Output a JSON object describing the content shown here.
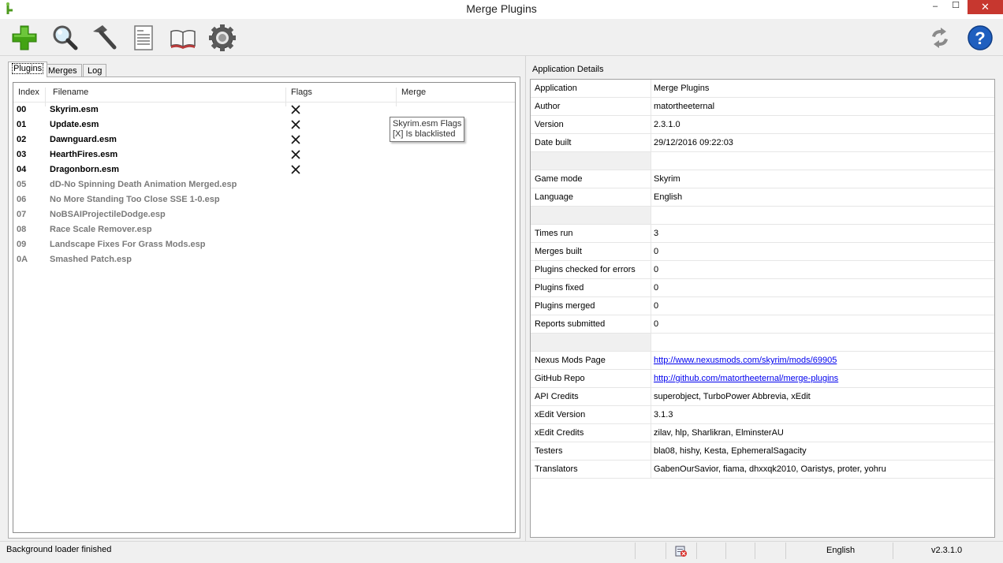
{
  "window": {
    "title": "Merge Plugins",
    "minimize": "–",
    "maximize": "☐",
    "close": "✕"
  },
  "tabs": [
    "Plugins",
    "Merges",
    "Log"
  ],
  "plugins": {
    "columns": [
      "Index",
      "Filename",
      "Flags",
      "Merge"
    ],
    "rows": [
      {
        "index": "00",
        "filename": "Skyrim.esm",
        "flag": true,
        "dim": false
      },
      {
        "index": "01",
        "filename": "Update.esm",
        "flag": true,
        "dim": false
      },
      {
        "index": "02",
        "filename": "Dawnguard.esm",
        "flag": true,
        "dim": false
      },
      {
        "index": "03",
        "filename": "HearthFires.esm",
        "flag": true,
        "dim": false
      },
      {
        "index": "04",
        "filename": "Dragonborn.esm",
        "flag": true,
        "dim": false
      },
      {
        "index": "05",
        "filename": "dD-No Spinning Death Animation Merged.esp",
        "flag": false,
        "dim": true
      },
      {
        "index": "06",
        "filename": "No More Standing Too Close SSE 1-0.esp",
        "flag": false,
        "dim": true
      },
      {
        "index": "07",
        "filename": "NoBSAIProjectileDodge.esp",
        "flag": false,
        "dim": true
      },
      {
        "index": "08",
        "filename": "Race Scale Remover.esp",
        "flag": false,
        "dim": true
      },
      {
        "index": "09",
        "filename": "Landscape Fixes For Grass Mods.esp",
        "flag": false,
        "dim": true
      },
      {
        "index": "0A",
        "filename": "Smashed Patch.esp",
        "flag": false,
        "dim": true
      }
    ],
    "tooltip": {
      "line1": "Skyrim.esm Flags",
      "line2": "[X] Is blacklisted"
    }
  },
  "details": {
    "heading": "Application Details",
    "rows": [
      {
        "key": "Application",
        "value": "Merge Plugins"
      },
      {
        "key": "Author",
        "value": "matortheeternal"
      },
      {
        "key": "Version",
        "value": "2.3.1.0"
      },
      {
        "key": "Date built",
        "value": "29/12/2016 09:22:03"
      },
      {
        "key": "",
        "value": "",
        "blank": true
      },
      {
        "key": "Game mode",
        "value": "Skyrim"
      },
      {
        "key": "Language",
        "value": "English"
      },
      {
        "key": "",
        "value": "",
        "blank": true
      },
      {
        "key": "Times run",
        "value": "3"
      },
      {
        "key": "Merges built",
        "value": "0"
      },
      {
        "key": "Plugins checked for errors",
        "value": "0"
      },
      {
        "key": "Plugins fixed",
        "value": "0"
      },
      {
        "key": "Plugins merged",
        "value": "0"
      },
      {
        "key": "Reports submitted",
        "value": "0"
      },
      {
        "key": "",
        "value": "",
        "blank": true
      },
      {
        "key": "Nexus Mods Page",
        "value": "http://www.nexusmods.com/skyrim/mods/69905",
        "link": true
      },
      {
        "key": "GitHub Repo",
        "value": "http://github.com/matortheeternal/merge-plugins",
        "link": true
      },
      {
        "key": "API Credits",
        "value": "superobject, TurboPower Abbrevia, xEdit"
      },
      {
        "key": "xEdit Version",
        "value": "3.1.3"
      },
      {
        "key": "xEdit Credits",
        "value": "zilav, hlp, Sharlikran, ElminsterAU"
      },
      {
        "key": "Testers",
        "value": "bla08, hishy, Kesta, EphemeralSagacity"
      },
      {
        "key": "Translators",
        "value": "GabenOurSavior, fiama, dhxxqk2010, Oaristys, proter, yohru"
      }
    ]
  },
  "status": {
    "message": "Background loader finished",
    "language": "English",
    "version": "v2.3.1.0"
  }
}
